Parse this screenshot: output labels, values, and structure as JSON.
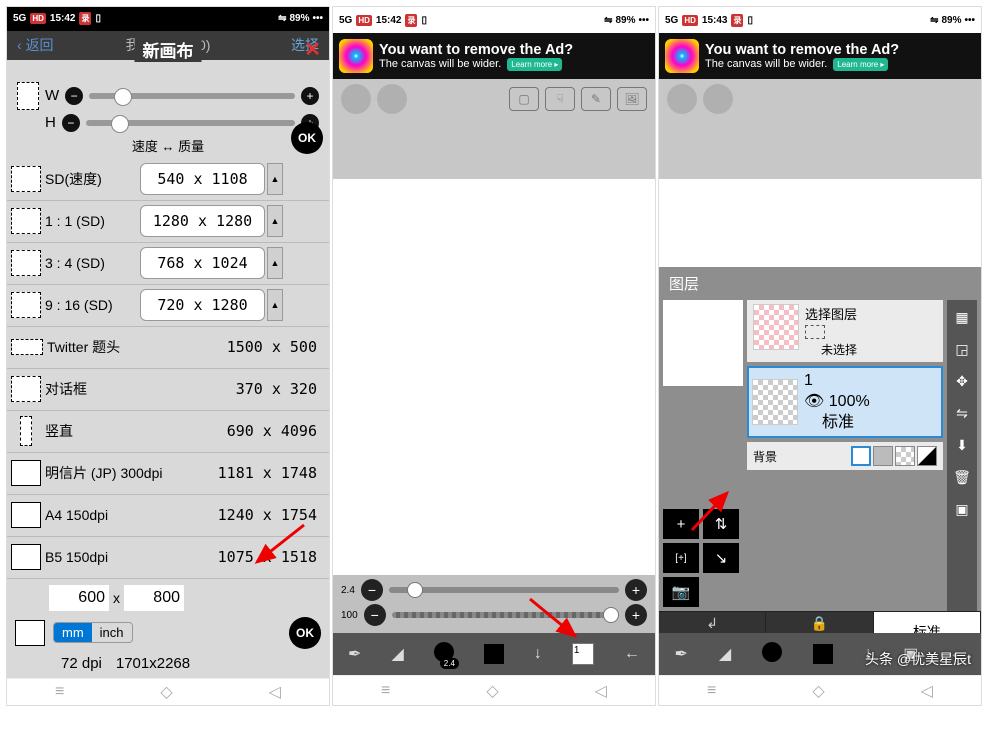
{
  "status": {
    "sig": "5G",
    "hd": "HD",
    "time1": "15:42",
    "time2": "15:42",
    "time3": "15:43",
    "wifi": "⇋",
    "batt": "89%",
    "dots": "•••"
  },
  "p1": {
    "back": "返回",
    "topTitle": "我的图库 (10)",
    "select": "选择",
    "dialogTitle": "新画布",
    "close": "✕",
    "W": "W",
    "H": "H",
    "OK": "OK",
    "caption": "速度 ↔ 质量",
    "rows": [
      {
        "label": "SD(速度)",
        "val": "540 x 1108",
        "dd": true,
        "dash": true
      },
      {
        "label": "1 : 1 (SD)",
        "val": "1280 x 1280",
        "dd": true,
        "dash": true
      },
      {
        "label": "3 : 4 (SD)",
        "val": "768 x 1024",
        "dd": true,
        "dash": true
      },
      {
        "label": "9 : 16 (SD)",
        "val": "720 x 1280",
        "dd": true,
        "dash": true
      },
      {
        "label": "Twitter 题头",
        "val": "1500 x 500",
        "dash": true,
        "wide": true
      },
      {
        "label": "对话框",
        "val": "370 x 320",
        "dash": true
      },
      {
        "label": "竖直",
        "val": "690 x 4096",
        "dash": true,
        "narrow": true
      },
      {
        "label": "明信片 (JP) 300dpi",
        "val": "1181 x 1748",
        "solid": true
      },
      {
        "label": "A4 150dpi",
        "val": "1240 x 1754",
        "solid": true
      },
      {
        "label": "B5 150dpi",
        "val": "1075 x 1518",
        "solid": true
      }
    ],
    "custom": {
      "w": "600",
      "by": "x",
      "h": "800",
      "mm": "mm",
      "inch": "inch",
      "dpi": "72 dpi",
      "px": "1701x2268"
    }
  },
  "ad": {
    "line1": "You want to remove the Ad?",
    "line2": "The canvas will be wider.",
    "btn": "Learn more ▸"
  },
  "p2": {
    "s1": "2.4",
    "s2": "100",
    "bbBadge": "2.4",
    "layersIdx": "1"
  },
  "p3": {
    "title": "图层",
    "selTitle": "选择图层",
    "unsel": "未选择",
    "layerNum": "1",
    "opacity": "100%",
    "blend": "标准",
    "bg": "背景",
    "clip": "剪切",
    "alpha": "阿尔法锁",
    "normal": "标准",
    "opLabel": "100%"
  },
  "wm": "头条 @优美星辰t"
}
